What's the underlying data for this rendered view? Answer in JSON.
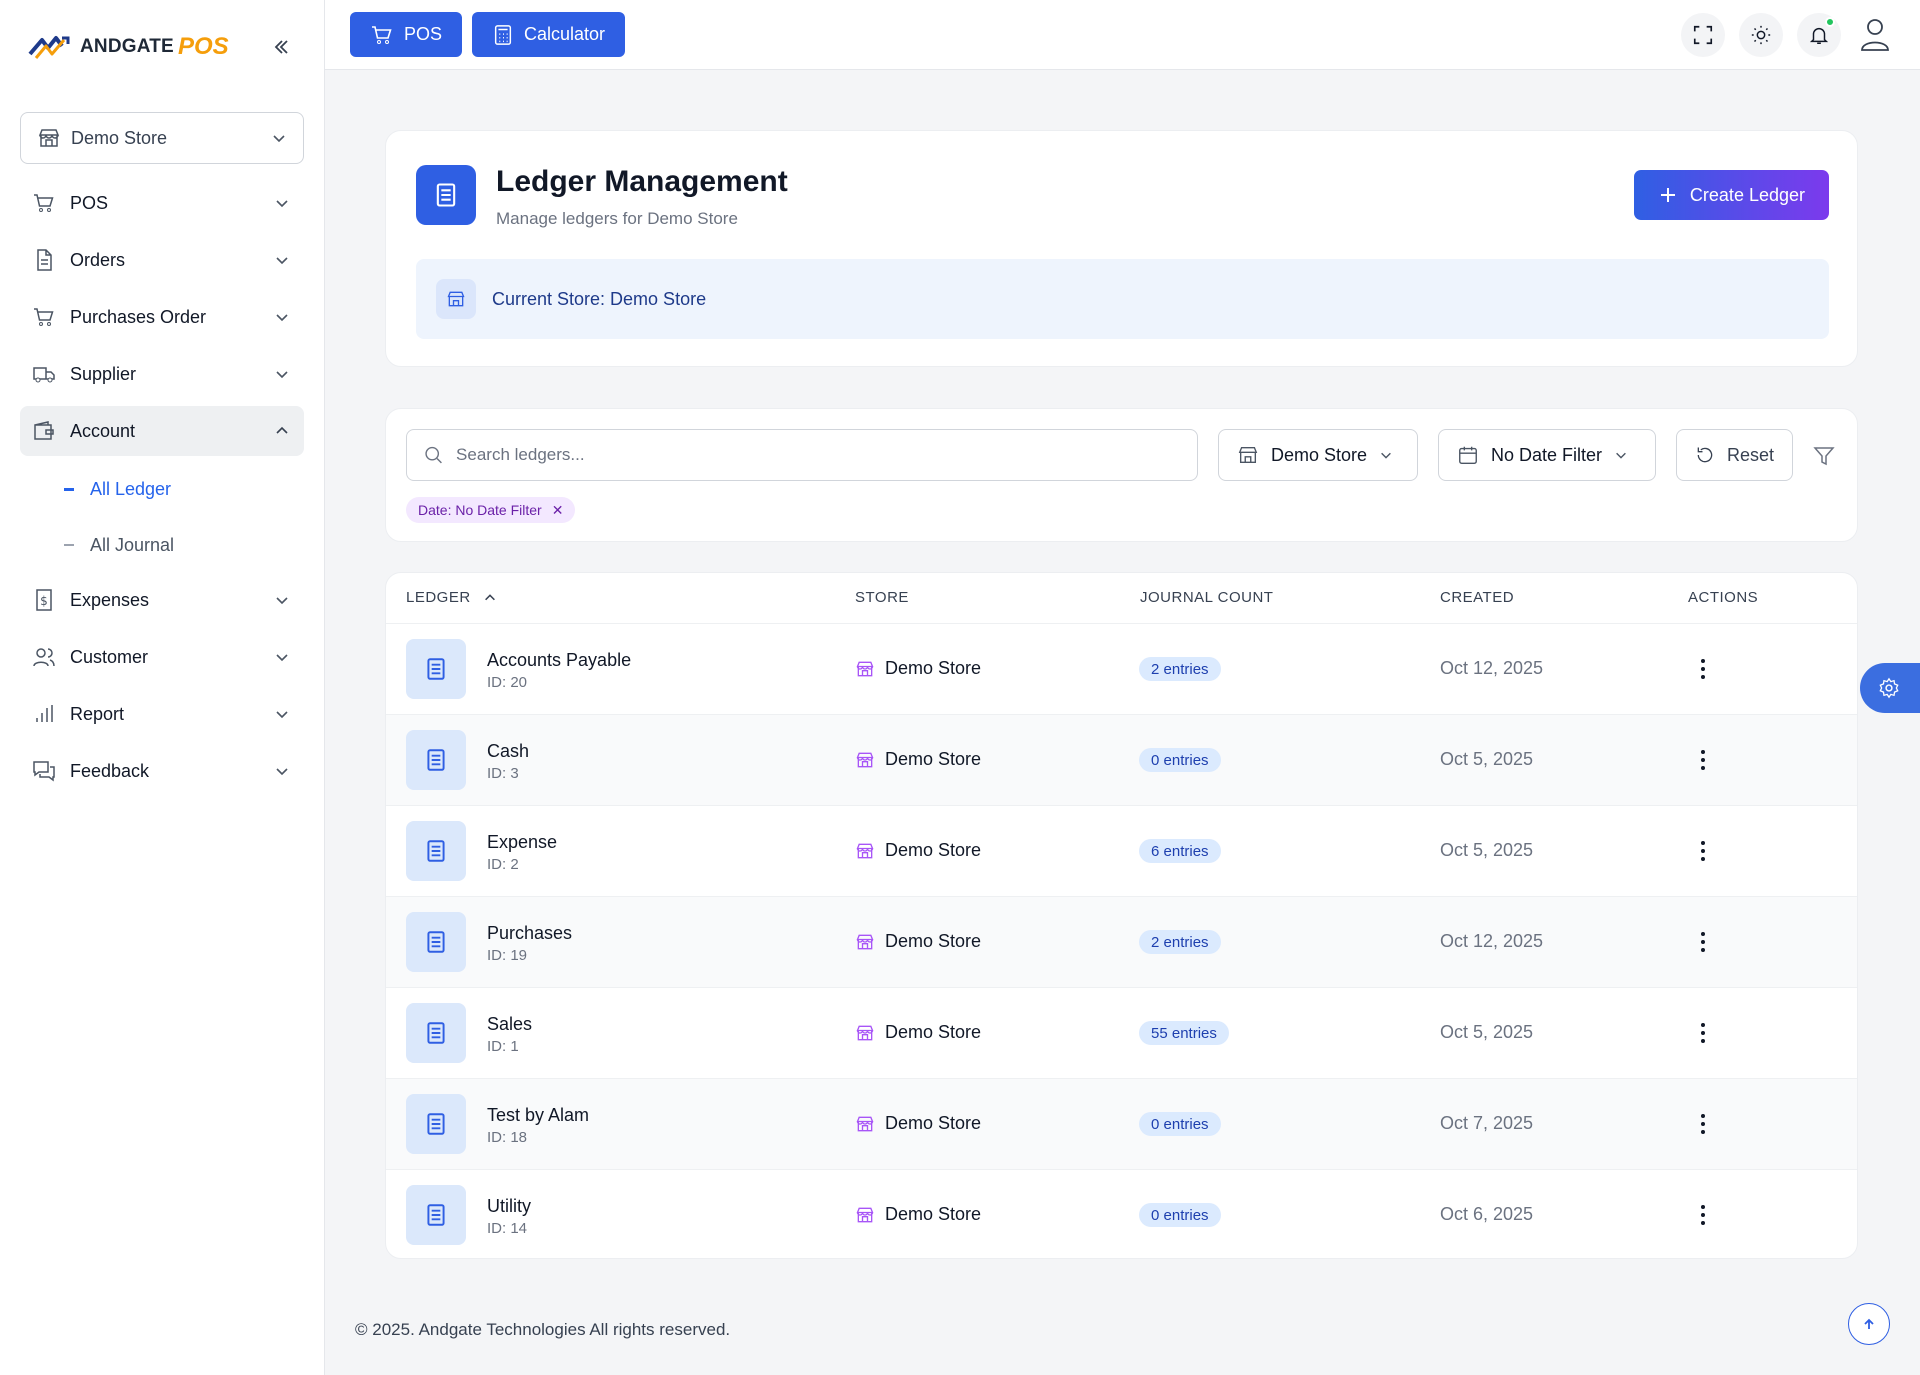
{
  "brand": {
    "name": "ANDGATE",
    "suffix": "POS"
  },
  "sidebar": {
    "store_select": "Demo Store",
    "items": [
      {
        "label": "POS",
        "icon": "cart-icon"
      },
      {
        "label": "Orders",
        "icon": "document-icon"
      },
      {
        "label": "Purchases Order",
        "icon": "cart-icon"
      },
      {
        "label": "Supplier",
        "icon": "truck-icon"
      },
      {
        "label": "Account",
        "icon": "wallet-icon",
        "expanded": true
      },
      {
        "label": "Expenses",
        "icon": "dollar-file-icon"
      },
      {
        "label": "Customer",
        "icon": "users-icon"
      },
      {
        "label": "Report",
        "icon": "bar-chart-icon"
      },
      {
        "label": "Feedback",
        "icon": "chat-icon"
      }
    ],
    "sub_items": [
      {
        "label": "All Ledger",
        "active": true
      },
      {
        "label": "All Journal",
        "active": false
      }
    ]
  },
  "topbar": {
    "pos_label": "POS",
    "calculator_label": "Calculator"
  },
  "header": {
    "title": "Ledger Management",
    "subtitle": "Manage ledgers for Demo Store",
    "create_label": "Create Ledger",
    "current_store": "Current Store: Demo Store"
  },
  "filters": {
    "search_placeholder": "Search ledgers...",
    "store": "Demo Store",
    "date": "No Date Filter",
    "reset": "Reset",
    "chip": "Date: No Date Filter"
  },
  "table": {
    "columns": [
      "LEDGER",
      "STORE",
      "JOURNAL COUNT",
      "CREATED",
      "ACTIONS"
    ],
    "rows": [
      {
        "name": "Accounts Payable",
        "id": "ID: 20",
        "store": "Demo Store",
        "count": "2 entries",
        "created": "Oct 12, 2025"
      },
      {
        "name": "Cash",
        "id": "ID: 3",
        "store": "Demo Store",
        "count": "0 entries",
        "created": "Oct 5, 2025"
      },
      {
        "name": "Expense",
        "id": "ID: 2",
        "store": "Demo Store",
        "count": "6 entries",
        "created": "Oct 5, 2025"
      },
      {
        "name": "Purchases",
        "id": "ID: 19",
        "store": "Demo Store",
        "count": "2 entries",
        "created": "Oct 12, 2025"
      },
      {
        "name": "Sales",
        "id": "ID: 1",
        "store": "Demo Store",
        "count": "55 entries",
        "created": "Oct 5, 2025"
      },
      {
        "name": "Test by Alam",
        "id": "ID: 18",
        "store": "Demo Store",
        "count": "0 entries",
        "created": "Oct 7, 2025"
      },
      {
        "name": "Utility",
        "id": "ID: 14",
        "store": "Demo Store",
        "count": "0 entries",
        "created": "Oct 6, 2025"
      }
    ]
  },
  "footer": "© 2025. Andgate Technologies All rights reserved.",
  "colors": {
    "primary": "#2f5fe3",
    "gradient_end": "#7c3aed",
    "notification": "#22c55e",
    "store_icon": "#a855f7"
  }
}
